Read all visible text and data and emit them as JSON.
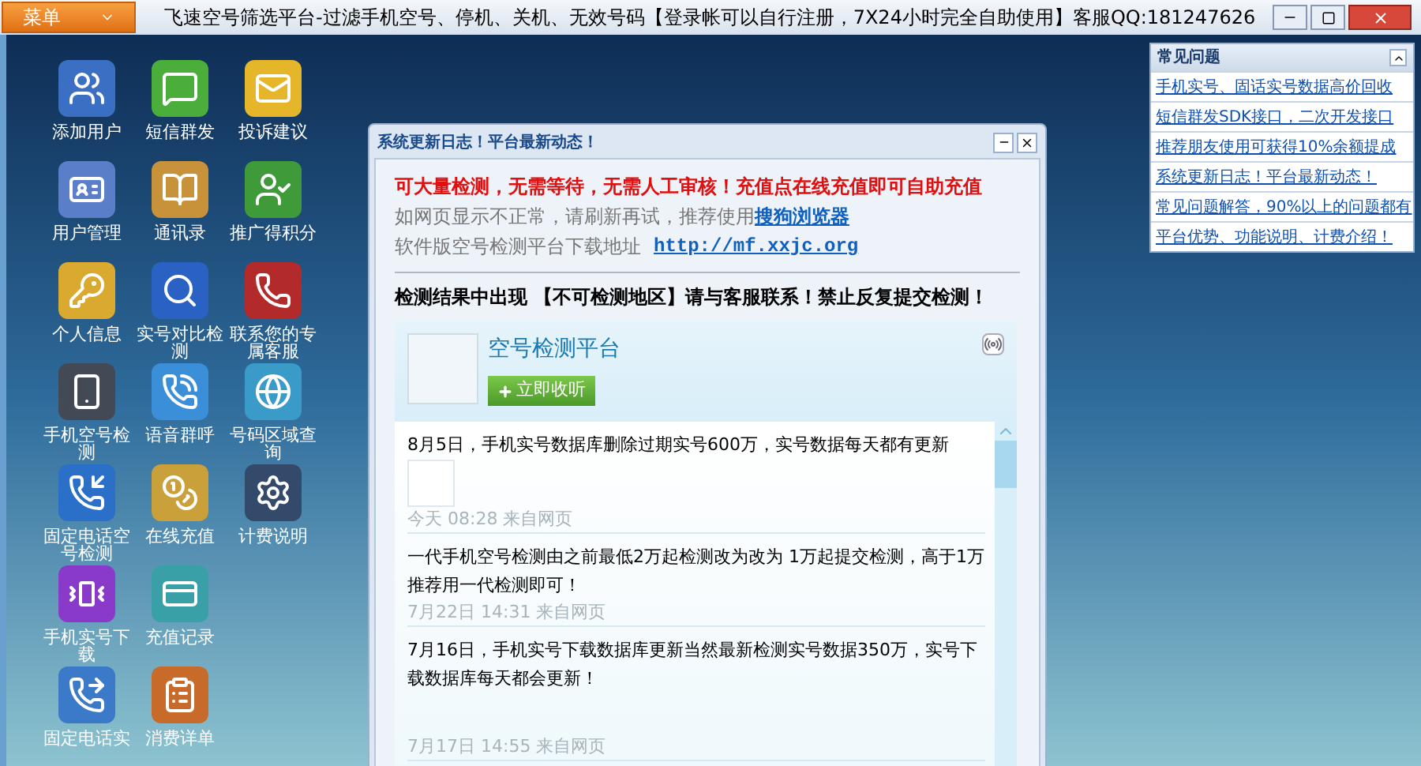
{
  "title_bar": {
    "menu_button": "菜单",
    "title": "飞速空号筛选平台-过滤手机空号、停机、关机、无效号码【登录帐可以自行注册，7X24小时完全自助使用】客服QQ:181247626"
  },
  "desktop_icons": [
    {
      "label": "添加用户"
    },
    {
      "label": "短信群发"
    },
    {
      "label": "投诉建议"
    },
    {
      "label": "用户管理"
    },
    {
      "label": "通讯录"
    },
    {
      "label": "推广得积分"
    },
    {
      "label": "个人信息"
    },
    {
      "label": "实号对比检测"
    },
    {
      "label": "联系您的专属客服"
    },
    {
      "label": "手机空号检测"
    },
    {
      "label": "语音群呼"
    },
    {
      "label": "号码区域查询"
    },
    {
      "label": "固定电话空号检测"
    },
    {
      "label": "在线充值"
    },
    {
      "label": "计费说明"
    },
    {
      "label": "手机实号下载"
    },
    {
      "label": "充值记录"
    },
    {
      "label": "固定电话实"
    },
    {
      "label": "消费详单"
    }
  ],
  "update_window": {
    "title": "系统更新日志！平台最新动态！",
    "notice": "可大量检测，无需等待，无需人工审核！充值点在线充值即可自助充值",
    "browser_hint": "如网页显示不正常，请刷新再试，推荐使用",
    "browser_link": "搜狗浏览器",
    "download_label": "软件版空号检测平台下载地址",
    "download_link": "http://mf.xxjc.org",
    "warning": "检测结果中出现 【不可检测地区】请与客服联系！禁止反复提交检测！",
    "widget": {
      "name": "空号检测平台",
      "follow_button": "立即收听",
      "posts": [
        {
          "text": "8月5日，手机实号数据库删除过期实号600万，实号数据每天都有更新",
          "image": true,
          "time": "今天  08:28 来自网页"
        },
        {
          "text": "一代手机空号检测由之前最低2万起检测改为改为 1万起提交检测，高于1万推荐用一代检测即可！",
          "image": false,
          "time": "7月22日  14:31 来自网页"
        },
        {
          "text": "7月16日，手机实号下载数据库更新当然最新检测实号数据350万，实号下载数据库每天都会更新！",
          "image": false,
          "time": "7月17日  14:55 来自网页"
        }
      ]
    }
  },
  "faq_panel": {
    "title": "常见问题",
    "links": [
      "手机实号、固话实号数据高价回收",
      "短信群发SDK接口，二次开发接口",
      "推荐朋友使用可获得10%余额提成",
      "系统更新日志！平台最新动态！",
      "常见问题解答，90%以上的问题都有",
      "平台优势、功能说明、计费介绍！"
    ]
  }
}
